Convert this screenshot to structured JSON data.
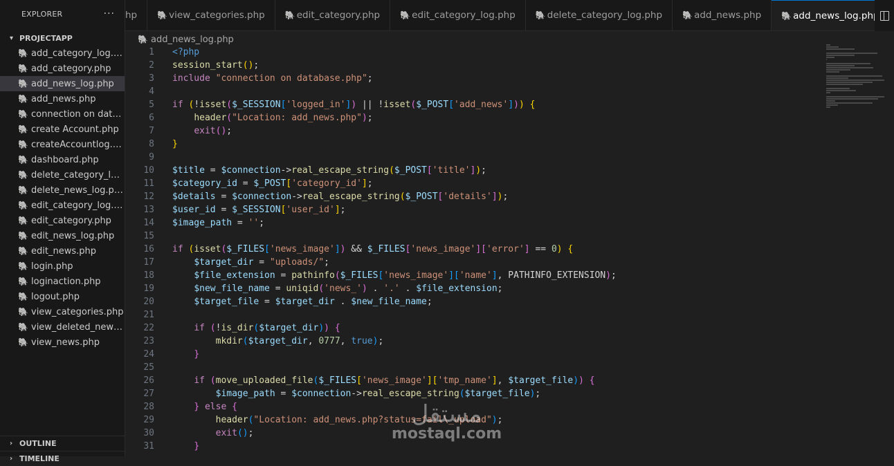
{
  "explorer": {
    "title": "EXPLORER",
    "more": "···",
    "project": "PROJECTAPP",
    "files": [
      "add_category_log.php",
      "add_category.php",
      "add_news_log.php",
      "add_news.php",
      "connection on database.php",
      "create Account.php",
      "createAccountlog.php",
      "dashboard.php",
      "delete_category_log.php",
      "delete_news_log.php",
      "edit_category_log.php",
      "edit_category.php",
      "edit_news_log.php",
      "edit_news.php",
      "login.php",
      "loginaction.php",
      "logout.php",
      "view_categories.php",
      "view_deleted_news.php",
      "view_news.php"
    ],
    "active_index": 2,
    "outline": "OUTLINE",
    "timeline": "TIMELINE"
  },
  "tabs": [
    {
      "label": "hp",
      "partial": true
    },
    {
      "label": "view_categories.php"
    },
    {
      "label": "edit_category.php"
    },
    {
      "label": "edit_category_log.php"
    },
    {
      "label": "delete_category_log.php"
    },
    {
      "label": "add_news.php"
    },
    {
      "label": "add_news_log.php",
      "active": true
    }
  ],
  "close_icon": "×",
  "breadcrumb": "add_news_log.php",
  "colors": {
    "keyword": "#c586c0",
    "blue_keyword": "#569cd6",
    "function": "#dcdcaa",
    "variable": "#9cdcfe",
    "string": "#ce9178",
    "number": "#b5cea8",
    "bracket1": "#ffd700",
    "bracket2": "#da70d6",
    "bracket3": "#179fff",
    "accent": "#0078d4"
  },
  "code_lines": [
    {
      "n": "1",
      "tokens": [
        [
          "<?php",
          "blue_keyword"
        ]
      ]
    },
    {
      "n": "2",
      "tokens": [
        [
          "session_start",
          "function"
        ],
        [
          "()",
          "bracket1"
        ],
        [
          ";",
          ""
        ]
      ]
    },
    {
      "n": "3",
      "tokens": [
        [
          "include",
          "keyword"
        ],
        [
          " ",
          ""
        ],
        [
          "\"connection on database.php\"",
          "string"
        ],
        [
          ";",
          ""
        ]
      ]
    },
    {
      "n": "4",
      "tokens": []
    },
    {
      "n": "5",
      "tokens": [
        [
          "if",
          "keyword"
        ],
        [
          " ",
          ""
        ],
        [
          "(",
          "bracket1"
        ],
        [
          "!",
          ""
        ],
        [
          "isset",
          "function"
        ],
        [
          "(",
          "bracket2"
        ],
        [
          "$_SESSION",
          "variable"
        ],
        [
          "[",
          "bracket3"
        ],
        [
          "'logged_in'",
          "string"
        ],
        [
          "]",
          "bracket3"
        ],
        [
          ")",
          "bracket2"
        ],
        [
          " || !",
          ""
        ],
        [
          "isset",
          "function"
        ],
        [
          "(",
          "bracket2"
        ],
        [
          "$_POST",
          "variable"
        ],
        [
          "[",
          "bracket3"
        ],
        [
          "'add_news'",
          "string"
        ],
        [
          "]",
          "bracket3"
        ],
        [
          ")",
          "bracket2"
        ],
        [
          ")",
          "bracket1"
        ],
        [
          " ",
          ""
        ],
        [
          "{",
          "bracket1"
        ]
      ]
    },
    {
      "n": "6",
      "tokens": [
        [
          "    ",
          ""
        ],
        [
          "header",
          "function"
        ],
        [
          "(",
          "bracket2"
        ],
        [
          "\"Location: add_news.php\"",
          "string"
        ],
        [
          ")",
          "bracket2"
        ],
        [
          ";",
          ""
        ]
      ]
    },
    {
      "n": "7",
      "tokens": [
        [
          "    ",
          ""
        ],
        [
          "exit",
          "keyword"
        ],
        [
          "()",
          "bracket2"
        ],
        [
          ";",
          ""
        ]
      ]
    },
    {
      "n": "8",
      "tokens": [
        [
          "}",
          "bracket1"
        ]
      ]
    },
    {
      "n": "9",
      "tokens": []
    },
    {
      "n": "10",
      "tokens": [
        [
          "$title",
          "variable"
        ],
        [
          " = ",
          ""
        ],
        [
          "$connection",
          "variable"
        ],
        [
          "->",
          ""
        ],
        [
          "real_escape_string",
          "function"
        ],
        [
          "(",
          "bracket1"
        ],
        [
          "$_POST",
          "variable"
        ],
        [
          "[",
          "bracket2"
        ],
        [
          "'title'",
          "string"
        ],
        [
          "]",
          "bracket2"
        ],
        [
          ")",
          "bracket1"
        ],
        [
          ";",
          ""
        ]
      ]
    },
    {
      "n": "11",
      "tokens": [
        [
          "$category_id",
          "variable"
        ],
        [
          " = ",
          ""
        ],
        [
          "$_POST",
          "variable"
        ],
        [
          "[",
          "bracket1"
        ],
        [
          "'category_id'",
          "string"
        ],
        [
          "]",
          "bracket1"
        ],
        [
          ";",
          ""
        ]
      ]
    },
    {
      "n": "12",
      "tokens": [
        [
          "$details",
          "variable"
        ],
        [
          " = ",
          ""
        ],
        [
          "$connection",
          "variable"
        ],
        [
          "->",
          ""
        ],
        [
          "real_escape_string",
          "function"
        ],
        [
          "(",
          "bracket1"
        ],
        [
          "$_POST",
          "variable"
        ],
        [
          "[",
          "bracket2"
        ],
        [
          "'details'",
          "string"
        ],
        [
          "]",
          "bracket2"
        ],
        [
          ")",
          "bracket1"
        ],
        [
          ";",
          ""
        ]
      ]
    },
    {
      "n": "13",
      "tokens": [
        [
          "$user_id",
          "variable"
        ],
        [
          " = ",
          ""
        ],
        [
          "$_SESSION",
          "variable"
        ],
        [
          "[",
          "bracket1"
        ],
        [
          "'user_id'",
          "string"
        ],
        [
          "]",
          "bracket1"
        ],
        [
          ";",
          ""
        ]
      ]
    },
    {
      "n": "14",
      "tokens": [
        [
          "$image_path",
          "variable"
        ],
        [
          " = ",
          ""
        ],
        [
          "''",
          "string"
        ],
        [
          ";",
          ""
        ]
      ]
    },
    {
      "n": "15",
      "tokens": []
    },
    {
      "n": "16",
      "tokens": [
        [
          "if",
          "keyword"
        ],
        [
          " ",
          ""
        ],
        [
          "(",
          "bracket1"
        ],
        [
          "isset",
          "function"
        ],
        [
          "(",
          "bracket2"
        ],
        [
          "$_FILES",
          "variable"
        ],
        [
          "[",
          "bracket3"
        ],
        [
          "'news_image'",
          "string"
        ],
        [
          "]",
          "bracket3"
        ],
        [
          ")",
          "bracket2"
        ],
        [
          " && ",
          ""
        ],
        [
          "$_FILES",
          "variable"
        ],
        [
          "[",
          "bracket2"
        ],
        [
          "'news_image'",
          "string"
        ],
        [
          "]",
          "bracket2"
        ],
        [
          "[",
          "bracket2"
        ],
        [
          "'error'",
          "string"
        ],
        [
          "]",
          "bracket2"
        ],
        [
          " == ",
          ""
        ],
        [
          "0",
          "number"
        ],
        [
          ")",
          "bracket1"
        ],
        [
          " ",
          ""
        ],
        [
          "{",
          "bracket1"
        ]
      ]
    },
    {
      "n": "17",
      "tokens": [
        [
          "    ",
          ""
        ],
        [
          "$target_dir",
          "variable"
        ],
        [
          " = ",
          ""
        ],
        [
          "\"uploads/\"",
          "string"
        ],
        [
          ";",
          ""
        ]
      ]
    },
    {
      "n": "18",
      "tokens": [
        [
          "    ",
          ""
        ],
        [
          "$file_extension",
          "variable"
        ],
        [
          " = ",
          ""
        ],
        [
          "pathinfo",
          "function"
        ],
        [
          "(",
          "bracket2"
        ],
        [
          "$_FILES",
          "variable"
        ],
        [
          "[",
          "bracket3"
        ],
        [
          "'news_image'",
          "string"
        ],
        [
          "]",
          "bracket3"
        ],
        [
          "[",
          "bracket3"
        ],
        [
          "'name'",
          "string"
        ],
        [
          "]",
          "bracket3"
        ],
        [
          ", PATHINFO_EXTENSION",
          ""
        ],
        [
          ")",
          "bracket2"
        ],
        [
          ";",
          ""
        ]
      ]
    },
    {
      "n": "19",
      "tokens": [
        [
          "    ",
          ""
        ],
        [
          "$new_file_name",
          "variable"
        ],
        [
          " = ",
          ""
        ],
        [
          "uniqid",
          "function"
        ],
        [
          "(",
          "bracket2"
        ],
        [
          "'news_'",
          "string"
        ],
        [
          ")",
          "bracket2"
        ],
        [
          " . ",
          ""
        ],
        [
          "'.'",
          "string"
        ],
        [
          " . ",
          ""
        ],
        [
          "$file_extension",
          "variable"
        ],
        [
          ";",
          ""
        ]
      ]
    },
    {
      "n": "20",
      "tokens": [
        [
          "    ",
          ""
        ],
        [
          "$target_file",
          "variable"
        ],
        [
          " = ",
          ""
        ],
        [
          "$target_dir",
          "variable"
        ],
        [
          " . ",
          ""
        ],
        [
          "$new_file_name",
          "variable"
        ],
        [
          ";",
          ""
        ]
      ]
    },
    {
      "n": "21",
      "tokens": []
    },
    {
      "n": "22",
      "tokens": [
        [
          "    ",
          ""
        ],
        [
          "if",
          "keyword"
        ],
        [
          " ",
          ""
        ],
        [
          "(",
          "bracket2"
        ],
        [
          "!",
          ""
        ],
        [
          "is_dir",
          "function"
        ],
        [
          "(",
          "bracket3"
        ],
        [
          "$target_dir",
          "variable"
        ],
        [
          ")",
          "bracket3"
        ],
        [
          ")",
          "bracket2"
        ],
        [
          " ",
          ""
        ],
        [
          "{",
          "bracket2"
        ]
      ]
    },
    {
      "n": "23",
      "tokens": [
        [
          "        ",
          ""
        ],
        [
          "mkdir",
          "function"
        ],
        [
          "(",
          "bracket3"
        ],
        [
          "$target_dir",
          "variable"
        ],
        [
          ", ",
          ""
        ],
        [
          "0777",
          "number"
        ],
        [
          ", ",
          ""
        ],
        [
          "true",
          "blue_keyword"
        ],
        [
          ")",
          "bracket3"
        ],
        [
          ";",
          ""
        ]
      ]
    },
    {
      "n": "24",
      "tokens": [
        [
          "    ",
          ""
        ],
        [
          "}",
          "bracket2"
        ]
      ]
    },
    {
      "n": "25",
      "tokens": []
    },
    {
      "n": "26",
      "tokens": [
        [
          "    ",
          ""
        ],
        [
          "if",
          "keyword"
        ],
        [
          " ",
          ""
        ],
        [
          "(",
          "bracket2"
        ],
        [
          "move_uploaded_file",
          "function"
        ],
        [
          "(",
          "bracket3"
        ],
        [
          "$_FILES",
          "variable"
        ],
        [
          "[",
          "bracket1"
        ],
        [
          "'news_image'",
          "string"
        ],
        [
          "]",
          "bracket1"
        ],
        [
          "[",
          "bracket1"
        ],
        [
          "'tmp_name'",
          "string"
        ],
        [
          "]",
          "bracket1"
        ],
        [
          ", ",
          ""
        ],
        [
          "$target_file",
          "variable"
        ],
        [
          ")",
          "bracket3"
        ],
        [
          ")",
          "bracket2"
        ],
        [
          " ",
          ""
        ],
        [
          "{",
          "bracket2"
        ]
      ]
    },
    {
      "n": "27",
      "tokens": [
        [
          "        ",
          ""
        ],
        [
          "$image_path",
          "variable"
        ],
        [
          " = ",
          ""
        ],
        [
          "$connection",
          "variable"
        ],
        [
          "->",
          ""
        ],
        [
          "real_escape_string",
          "function"
        ],
        [
          "(",
          "bracket3"
        ],
        [
          "$target_file",
          "variable"
        ],
        [
          ")",
          "bracket3"
        ],
        [
          ";",
          ""
        ]
      ]
    },
    {
      "n": "28",
      "tokens": [
        [
          "    ",
          ""
        ],
        [
          "}",
          "bracket2"
        ],
        [
          " ",
          ""
        ],
        [
          "else",
          "keyword"
        ],
        [
          " ",
          ""
        ],
        [
          "{",
          "bracket2"
        ]
      ]
    },
    {
      "n": "29",
      "tokens": [
        [
          "        ",
          ""
        ],
        [
          "header",
          "function"
        ],
        [
          "(",
          "bracket3"
        ],
        [
          "\"Location: add_news.php?status=fail\\_upload\"",
          "string"
        ],
        [
          ")",
          "bracket3"
        ],
        [
          ";",
          ""
        ]
      ]
    },
    {
      "n": "30",
      "tokens": [
        [
          "        ",
          ""
        ],
        [
          "exit",
          "keyword"
        ],
        [
          "()",
          "bracket3"
        ],
        [
          ";",
          ""
        ]
      ]
    },
    {
      "n": "31",
      "tokens": [
        [
          "    ",
          ""
        ],
        [
          "}",
          "bracket2"
        ]
      ]
    }
  ],
  "watermark": {
    "arabic": "مستقل",
    "latin": "mostaql.com"
  }
}
